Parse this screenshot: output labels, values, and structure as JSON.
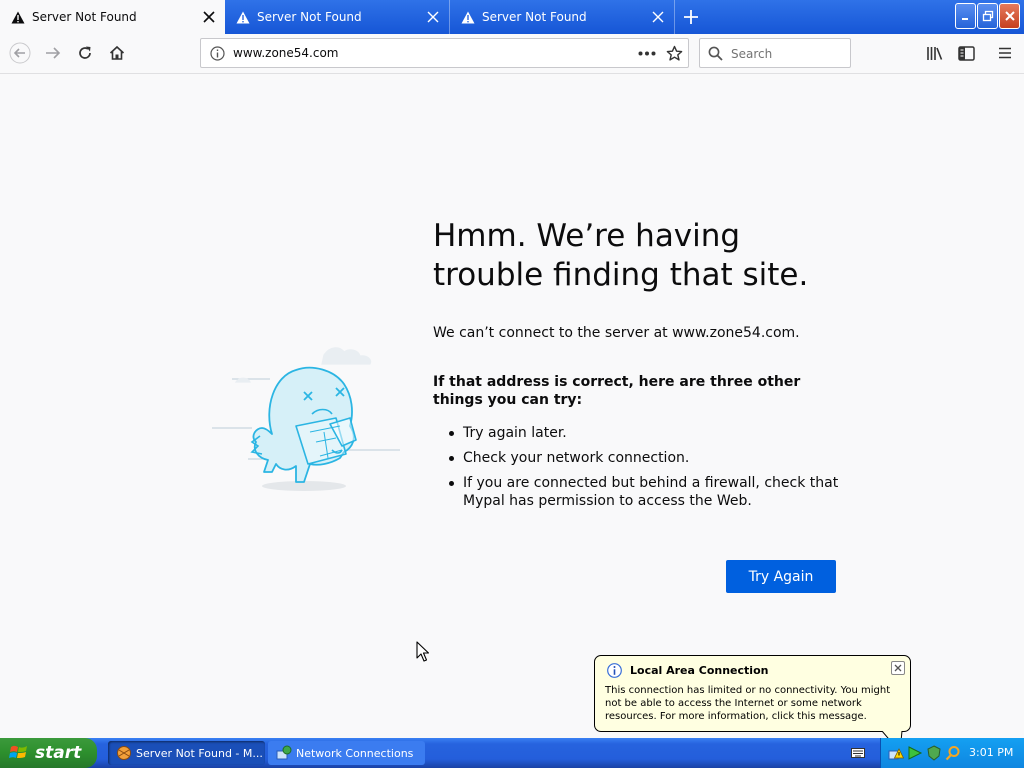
{
  "tabs": [
    {
      "title": "Server Not Found",
      "active": true
    },
    {
      "title": "Server Not Found",
      "active": false
    },
    {
      "title": "Server Not Found",
      "active": false
    }
  ],
  "navbar": {
    "url": "www.zone54.com",
    "search_placeholder": "Search"
  },
  "error": {
    "title": "Hmm. We’re having trouble finding that site.",
    "message": "We can’t connect to the server at www.zone54.com.",
    "tips_heading": "If that address is correct, here are three other things you can try:",
    "tips": [
      "Try again later.",
      "Check your network connection.",
      "If you are connected but behind a firewall, check that Mypal has permission to access the Web."
    ],
    "button": "Try Again"
  },
  "balloon": {
    "title": "Local Area Connection",
    "body": "This connection has limited or no connectivity. You might not be able to access the Internet or some network resources. For more information, click this message."
  },
  "taskbar": {
    "start": "start",
    "items": [
      "Server Not Found - M...",
      "Network Connections"
    ],
    "clock": "3:01 PM"
  },
  "colors": {
    "accent": "#0060df",
    "titlebar": "#2663de",
    "start": "#2d8f2d"
  }
}
